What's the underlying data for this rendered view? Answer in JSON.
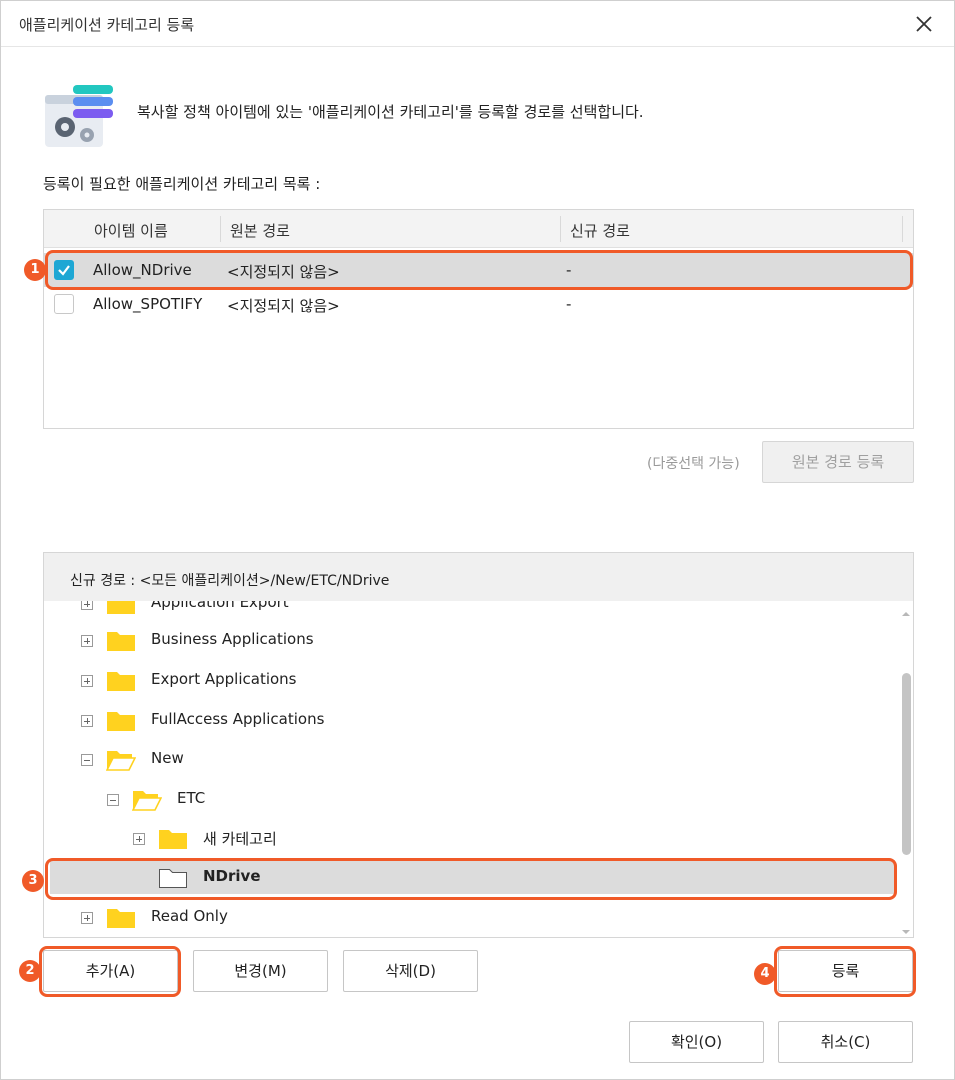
{
  "window": {
    "title": "애플리케이션 카테고리 등록",
    "close_icon": "close-icon"
  },
  "description": "복사할 정책 아이템에 있는 '애플리케이션 카테고리'를 등록할 경로를 선택합니다.",
  "list_title": "등록이 필요한 애플리케이션 카테고리 목록 :",
  "table": {
    "columns": [
      "아이템 이름",
      "원본 경로",
      "신규 경로"
    ],
    "rows": [
      {
        "checked": true,
        "name": "Allow_NDrive",
        "source": "<지정되지 않음>",
        "target": "-"
      },
      {
        "checked": false,
        "name": "Allow_SPOTIFY",
        "source": "<지정되지 않음>",
        "target": "-"
      }
    ]
  },
  "multi_select_hint": "(다중선택 가능)",
  "register_source_button": "원본 경로 등록",
  "tree": {
    "path_label": "신규 경로 : <모든 애플리케이션>/New/ETC/NDrive",
    "nodes": [
      {
        "label": "Application Export"
      },
      {
        "label": "Business Applications"
      },
      {
        "label": "Export Applications"
      },
      {
        "label": "FullAccess Applications"
      },
      {
        "label": "New"
      },
      {
        "label": "ETC"
      },
      {
        "label": "새 카테고리"
      },
      {
        "label": "NDrive"
      },
      {
        "label": "Read Only"
      }
    ]
  },
  "buttons": {
    "add": "추가(A)",
    "change": "변경(M)",
    "delete": "삭제(D)",
    "register": "등록",
    "ok": "확인(O)",
    "cancel": "취소(C)"
  },
  "callouts": [
    "1",
    "2",
    "3",
    "4"
  ],
  "colors": {
    "callout": "#f05a28",
    "checkbox_checked": "#1ea7d4",
    "folder": "#ffd21f",
    "selection": "#dcdcdc"
  }
}
